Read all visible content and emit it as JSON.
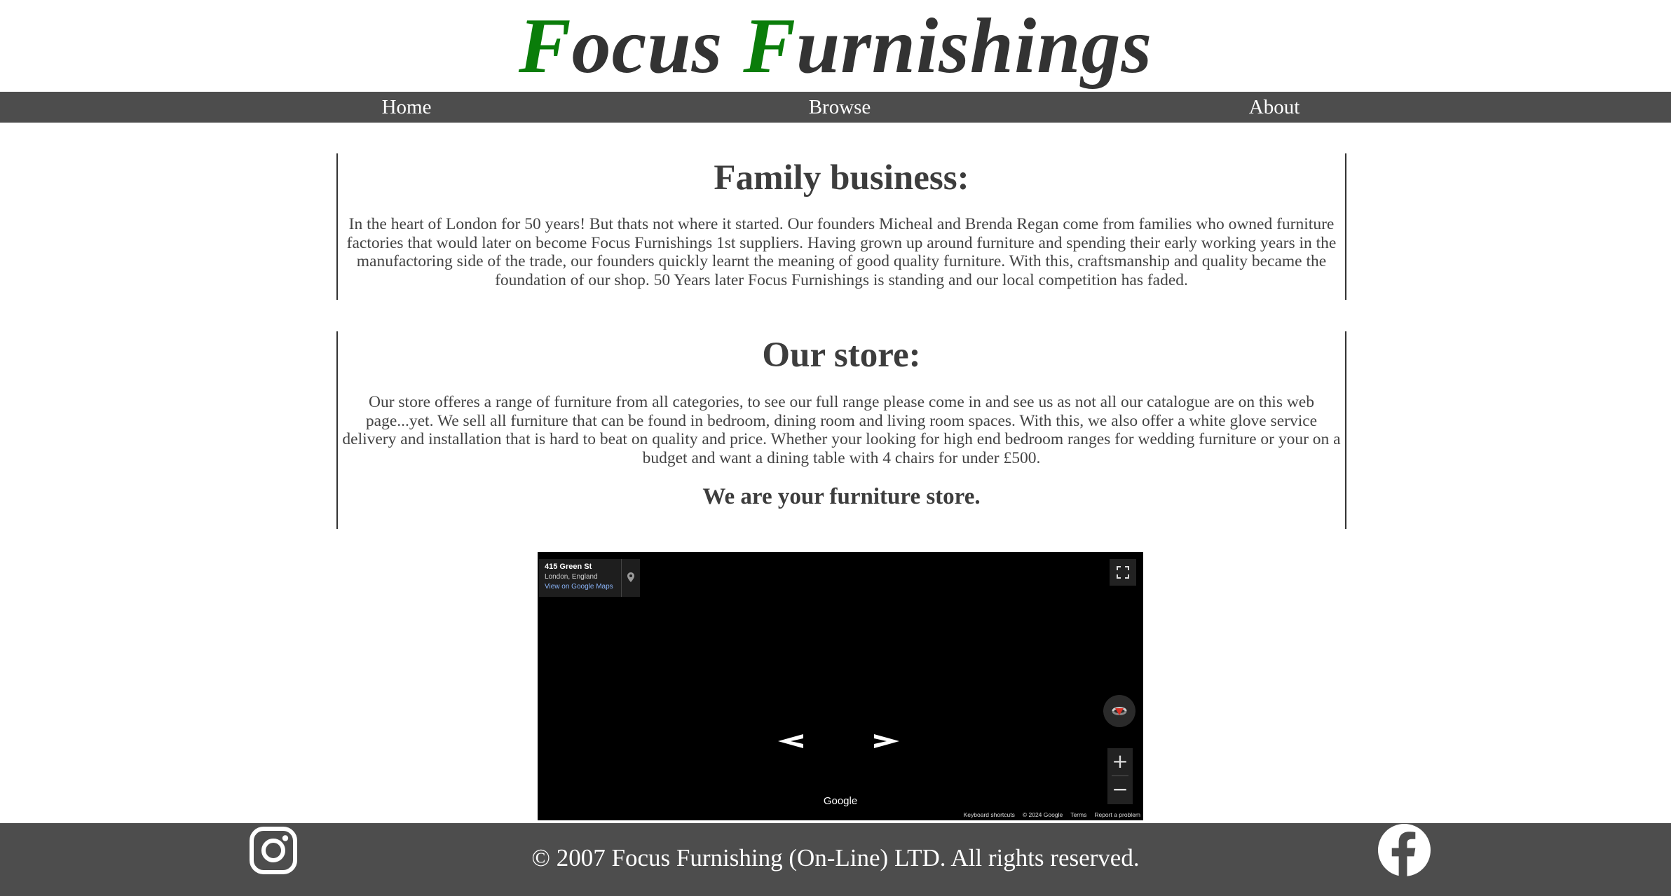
{
  "header": {
    "logo_cap1": "F",
    "logo_rest1": "ocus ",
    "logo_cap2": "F",
    "logo_rest2": "urnishings",
    "logo_accent_color": "#0a7d0a"
  },
  "nav": {
    "home": "Home",
    "browse": "Browse",
    "about": "About"
  },
  "family": {
    "heading": "Family business:",
    "text": "In the heart of London for 50 years! But thats not where it started. Our founders Micheal and Brenda Regan come from families who owned furniture factories that would later on become Focus Furnishings 1st suppliers. Having grown up around furniture and spending their early working years in the manufactoring side of the trade, our founders quickly learnt the meaning of good quality furniture. With this, craftsmanship and quality became the foundation of our shop. 50 Years later Focus Furnishings is standing and our local competition has faded."
  },
  "store": {
    "heading": "Our store:",
    "text": "Our store offeres a range of furniture from all categories, to see our full range please come in and see us as not all our catalogue are on this web page...yet. We sell all furniture that can be found in bedroom, dining room and living room spaces. With this, we also offer a white glove service delivery and installation that is hard to beat on quality and price. Whether your looking for high end bedroom ranges for wedding furniture or your on a budget and want a dining table with 4 chairs for under £500.",
    "tagline": "We are your furniture store."
  },
  "streetview": {
    "address": "415 Green St",
    "locality": "London, England",
    "maps_link": "View on Google Maps",
    "zoom_in": "+",
    "zoom_out": "−",
    "brand": "Google",
    "keyboard": "Keyboard shortcuts",
    "copyright": "© 2024 Google",
    "terms": "Terms",
    "report": "Report a problem",
    "icons": [
      "map-pin-icon",
      "fullscreen-icon",
      "compass-icon",
      "arrow-left-icon",
      "arrow-right-icon"
    ]
  },
  "footer": {
    "copyright": "© 2007 Focus Furnishing (On-Line) LTD. All rights reserved.",
    "icons": [
      "instagram-icon",
      "facebook-icon"
    ]
  }
}
